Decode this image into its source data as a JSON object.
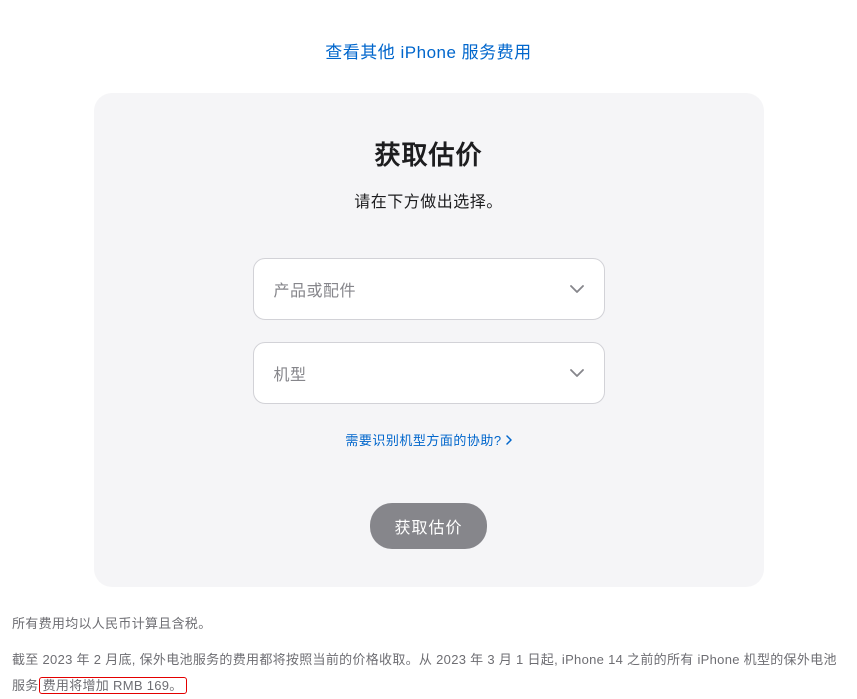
{
  "topLink": {
    "text": "查看其他 iPhone 服务费用"
  },
  "card": {
    "title": "获取估价",
    "subtitle": "请在下方做出选择。",
    "select1": {
      "placeholder": "产品或配件"
    },
    "select2": {
      "placeholder": "机型"
    },
    "helpLink": "需要识别机型方面的协助?",
    "submitLabel": "获取估价"
  },
  "footer": {
    "line1": "所有费用均以人民币计算且含税。",
    "line2a": "截至 2023 年 2 月底, 保外电池服务的费用都将按照当前的价格收取。从 2023 年 3 月 1 日起, iPhone 14 之前的所有 iPhone 机型的保外电池服务",
    "line2b": "费用将增加 RMB 169。"
  }
}
